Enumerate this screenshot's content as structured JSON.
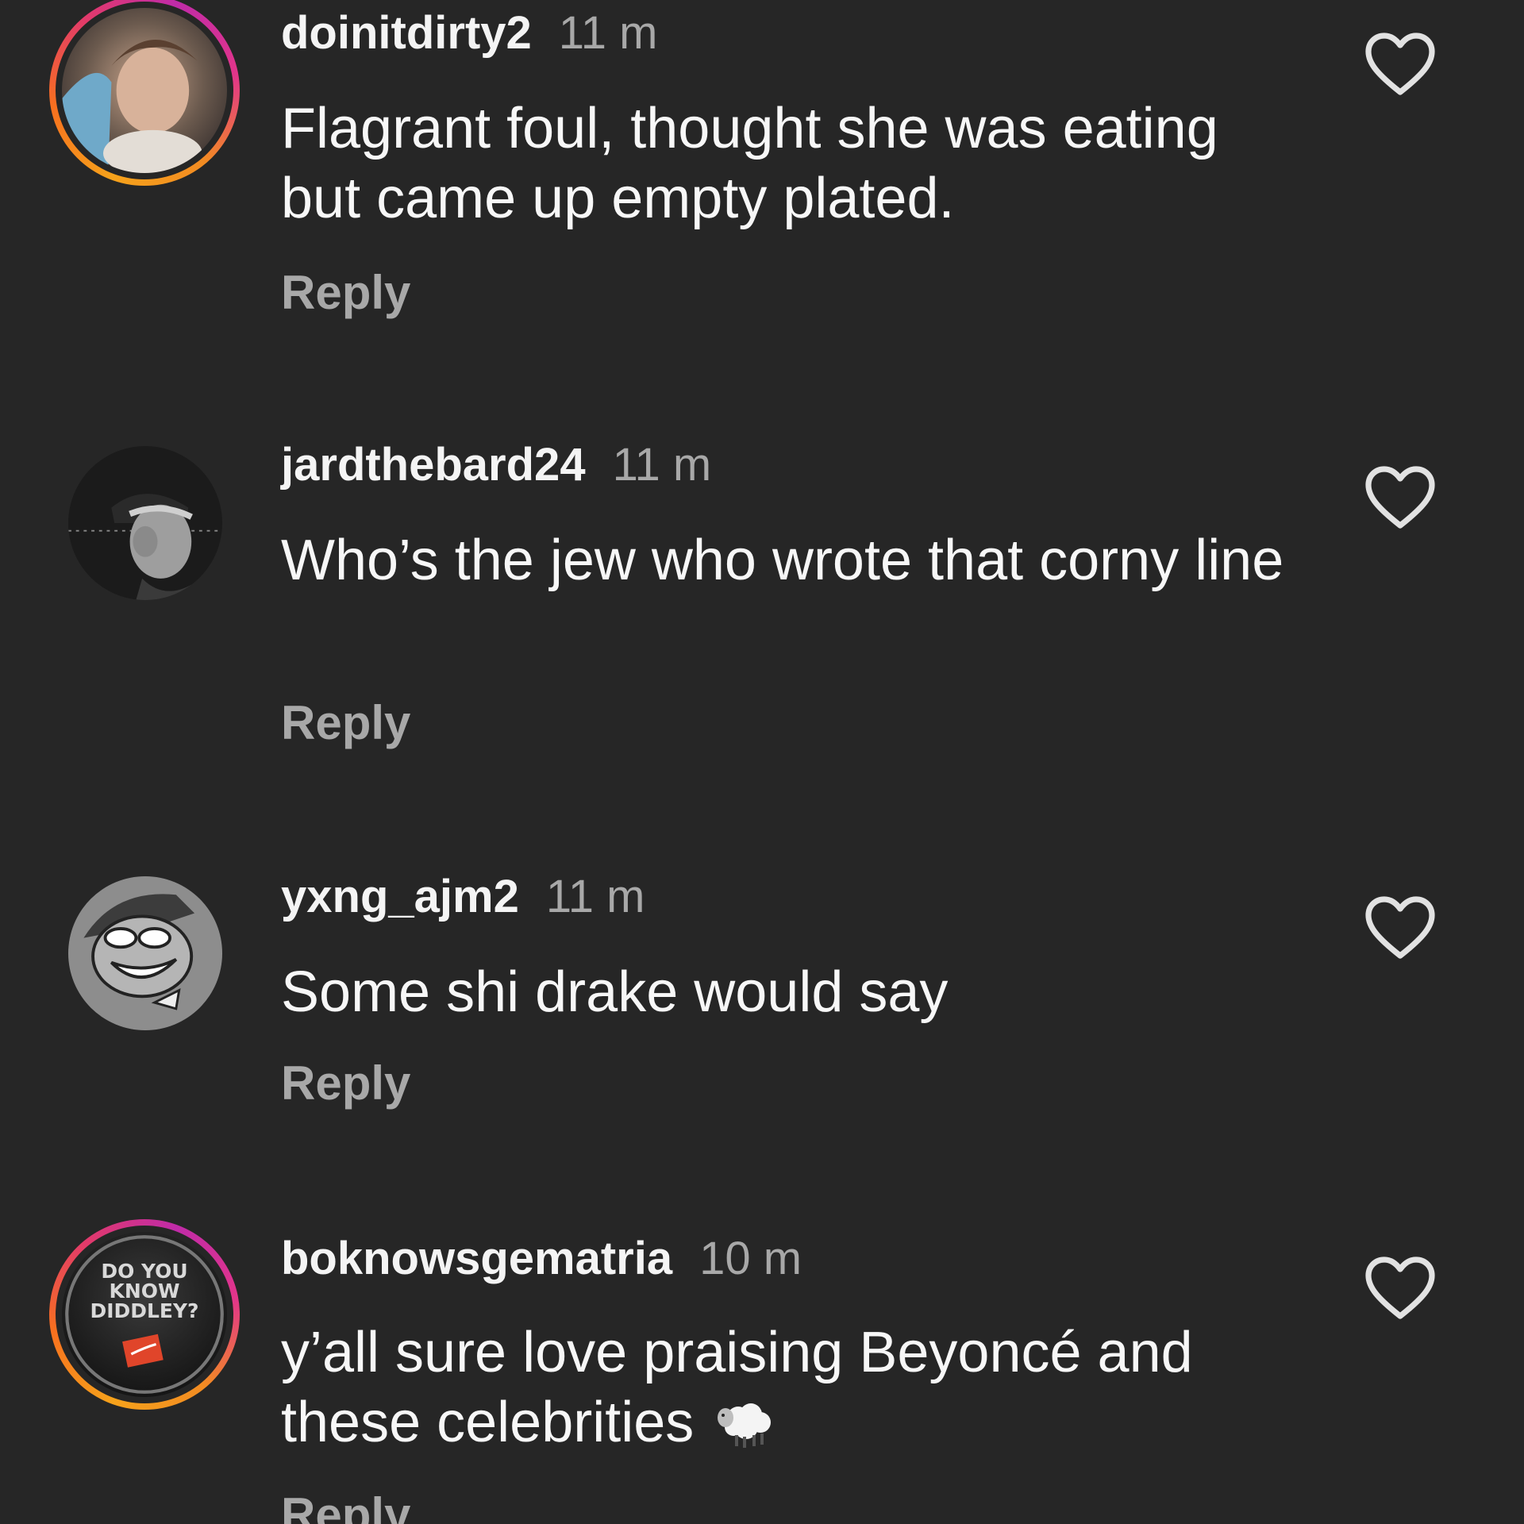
{
  "comments": [
    {
      "username": "doinitdirty2",
      "time": "11 m",
      "text": "Flagrant foul, thought she was eating but came up empty plated.",
      "reply_label": "Reply",
      "avatar_icon": "profile-photo-with-story-ring",
      "like_icon": "heart-outline-icon"
    },
    {
      "username": "jardthebard24",
      "time": "11 m",
      "text": "Who’s the jew who wrote that corny line",
      "reply_label": "Reply",
      "avatar_icon": "profile-photo",
      "like_icon": "heart-outline-icon"
    },
    {
      "username": "yxng_ajm2",
      "time": "11 m",
      "text": "Some shi drake would say",
      "reply_label": "Reply",
      "avatar_icon": "cartoon-profile-photo",
      "like_icon": "heart-outline-icon"
    },
    {
      "username": "boknowsgematria",
      "time": "10 m",
      "text": "y’all sure love praising Beyoncé and these celebrities",
      "emoji": "sheep-emoji",
      "reply_label": "Reply",
      "avatar_icon": "button-badge-profile-photo-with-story-ring",
      "avatar_text": [
        "DO YOU",
        "KNOW",
        "DIDDLEY?"
      ],
      "like_icon": "heart-outline-icon"
    }
  ],
  "colors": {
    "background": "#262626",
    "primary_text": "#f4f4f4",
    "secondary_text": "#a8a8a8",
    "story_ring_start": "#f6a21b",
    "story_ring_end": "#c02ba8"
  }
}
